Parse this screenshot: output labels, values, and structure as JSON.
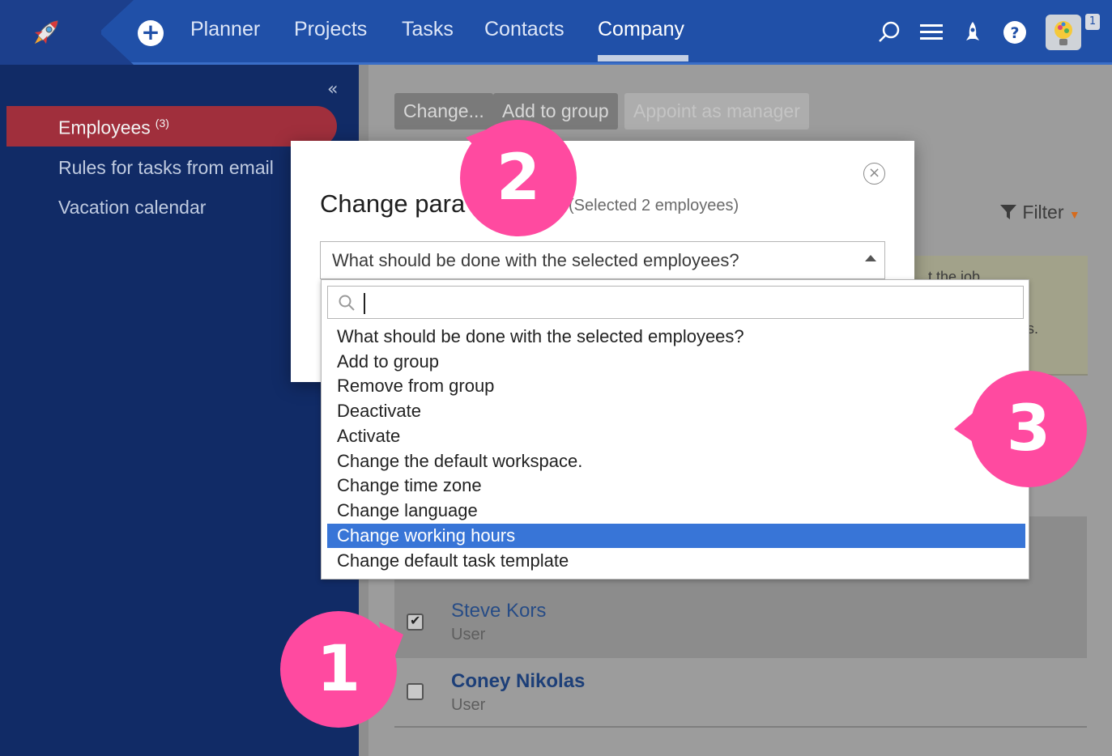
{
  "topbar": {
    "nav": [
      {
        "label": "Planner",
        "active": false
      },
      {
        "label": "Projects",
        "active": false
      },
      {
        "label": "Tasks",
        "active": false
      },
      {
        "label": "Contacts",
        "active": false
      },
      {
        "label": "Company",
        "active": true
      }
    ],
    "icons": [
      "rocket-logo-icon",
      "plus-icon",
      "search-icon",
      "menu-icon",
      "rocket-icon",
      "help-icon"
    ],
    "avatar_badge": "1"
  },
  "sidebar": {
    "collapse_icon": "«",
    "items": [
      {
        "label": "Employees",
        "count": "(3)",
        "active": true
      },
      {
        "label": "Rules for tasks from email",
        "active": false
      },
      {
        "label": "Vacation calendar",
        "active": false
      }
    ]
  },
  "toolbar": {
    "change": "Change...",
    "add_to_group": "Add to group",
    "appoint_manager": "Appoint as manager"
  },
  "filter": {
    "label": "Filter"
  },
  "notice": {
    "line1": "…t the job",
    "line2": "s."
  },
  "employees": [
    {
      "name": "Steve Kors",
      "role": "User",
      "checked": true
    },
    {
      "name": "Coney Nikolas",
      "role": "User",
      "checked": false
    }
  ],
  "modal": {
    "title": "Change para",
    "subtitle": "(Selected 2 employees)",
    "select_value": "What should be done with the selected employees?",
    "close_icon": "close-icon"
  },
  "dropdown": {
    "search_value": "",
    "options": [
      "What should be done with the selected employees?",
      "Add to group",
      "Remove from group",
      "Deactivate",
      "Activate",
      "Change the default workspace.",
      "Change time zone",
      "Change language",
      "Change working hours",
      "Change default task template"
    ],
    "selected_index": 8
  },
  "callouts": [
    "1",
    "2",
    "3"
  ],
  "colors": {
    "topbar": "#2050a8",
    "sidebar": "#112b66",
    "active_item": "#a02f3c",
    "callout": "#ff4aa0",
    "selected_option": "#3875d7"
  }
}
